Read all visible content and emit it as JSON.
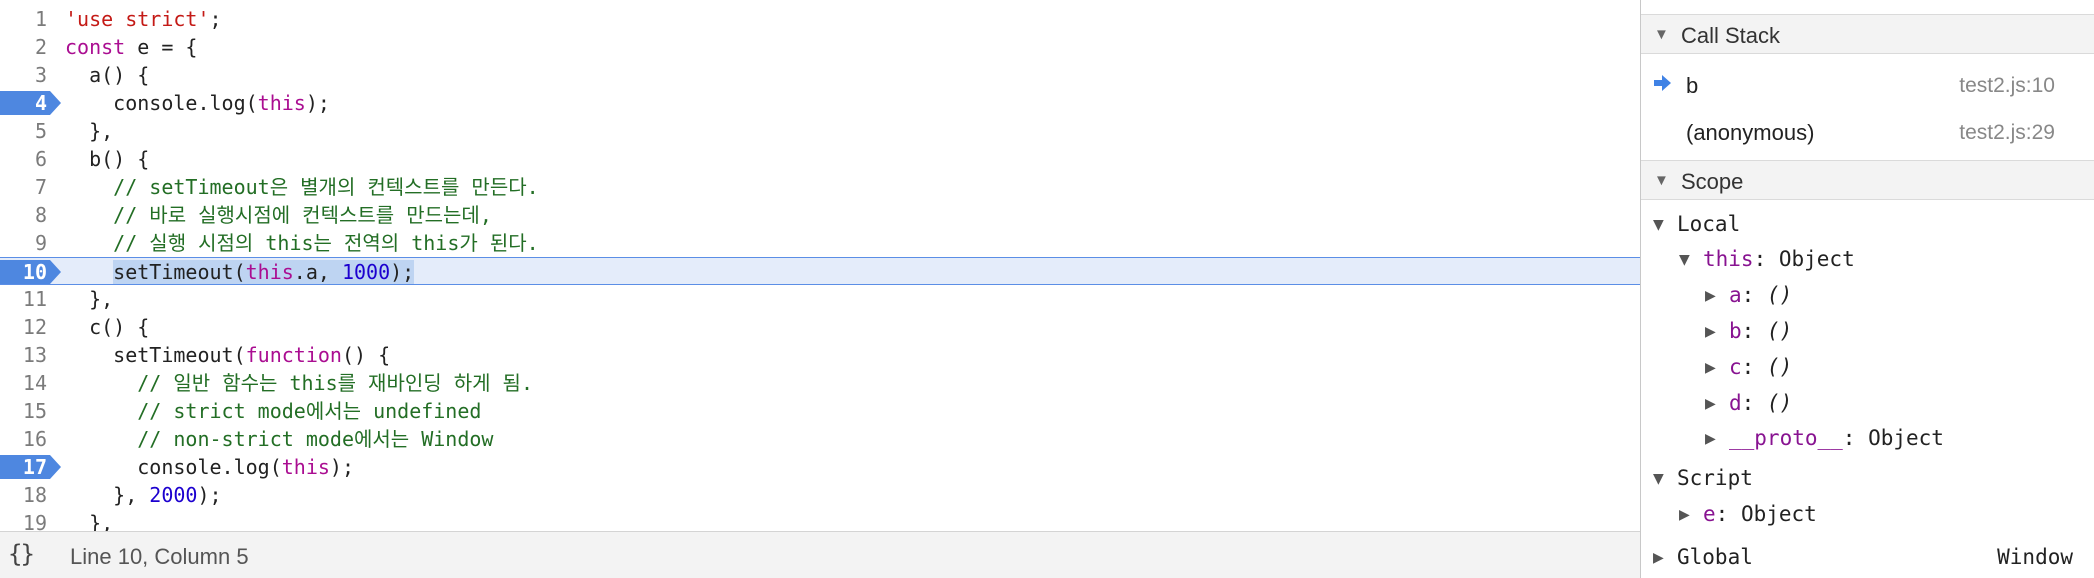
{
  "editor": {
    "lines": [
      {
        "num": "1",
        "tokens": [
          [
            "str",
            "'use strict'"
          ],
          [
            "plain",
            ";"
          ]
        ]
      },
      {
        "num": "2",
        "tokens": [
          [
            "kw",
            "const"
          ],
          [
            "plain",
            " e = {"
          ]
        ]
      },
      {
        "num": "3",
        "tokens": [
          [
            "plain",
            "  a() {"
          ]
        ]
      },
      {
        "num": "4",
        "breakpoint": true,
        "tokens": [
          [
            "plain",
            "    console.log("
          ],
          [
            "kw",
            "this"
          ],
          [
            "plain",
            ");"
          ]
        ]
      },
      {
        "num": "5",
        "tokens": [
          [
            "plain",
            "  },"
          ]
        ]
      },
      {
        "num": "6",
        "tokens": [
          [
            "plain",
            "  b() {"
          ]
        ]
      },
      {
        "num": "7",
        "tokens": [
          [
            "plain",
            "    "
          ],
          [
            "com",
            "// setTimeout은 별개의 컨텍스트를 만든다."
          ]
        ]
      },
      {
        "num": "8",
        "tokens": [
          [
            "plain",
            "    "
          ],
          [
            "com",
            "// 바로 실행시점에 컨텍스트를 만드는데,"
          ]
        ]
      },
      {
        "num": "9",
        "tokens": [
          [
            "plain",
            "    "
          ],
          [
            "com",
            "// 실행 시점의 this는 전역의 this가 된다."
          ]
        ]
      },
      {
        "num": "10",
        "breakpoint": true,
        "current": true,
        "tokens": [
          [
            "plain",
            "    "
          ],
          [
            "hl-plain",
            "setTimeout("
          ],
          [
            "hl-kw",
            "this"
          ],
          [
            "hl-plain",
            ".a, "
          ],
          [
            "hl-num",
            "1000"
          ],
          [
            "hl-plain",
            ");"
          ]
        ]
      },
      {
        "num": "11",
        "tokens": [
          [
            "plain",
            "  },"
          ]
        ]
      },
      {
        "num": "12",
        "tokens": [
          [
            "plain",
            "  c() {"
          ]
        ]
      },
      {
        "num": "13",
        "tokens": [
          [
            "plain",
            "    setTimeout("
          ],
          [
            "kw",
            "function"
          ],
          [
            "plain",
            "() {"
          ]
        ]
      },
      {
        "num": "14",
        "tokens": [
          [
            "plain",
            "      "
          ],
          [
            "com",
            "// 일반 함수는 this를 재바인딩 하게 됨."
          ]
        ]
      },
      {
        "num": "15",
        "tokens": [
          [
            "plain",
            "      "
          ],
          [
            "com",
            "// strict mode에서는 undefined"
          ]
        ]
      },
      {
        "num": "16",
        "tokens": [
          [
            "plain",
            "      "
          ],
          [
            "com",
            "// non-strict mode에서는 Window"
          ]
        ]
      },
      {
        "num": "17",
        "breakpoint": true,
        "tokens": [
          [
            "plain",
            "      console.log("
          ],
          [
            "kw",
            "this"
          ],
          [
            "plain",
            ");"
          ]
        ]
      },
      {
        "num": "18",
        "tokens": [
          [
            "plain",
            "    }, "
          ],
          [
            "num",
            "2000"
          ],
          [
            "plain",
            ");"
          ]
        ]
      },
      {
        "num": "19",
        "tokens": [
          [
            "plain",
            "  },"
          ]
        ]
      }
    ],
    "status": {
      "format_icon": "{}",
      "cursor_position": "Line 10, Column 5"
    }
  },
  "sidebar": {
    "call_stack": {
      "title": "Call Stack",
      "frames": [
        {
          "fn": "b",
          "location": "test2.js:10",
          "current": true
        },
        {
          "fn": "(anonymous)",
          "location": "test2.js:29",
          "current": false
        }
      ]
    },
    "scope": {
      "title": "Scope",
      "local_label": "Local",
      "this_name": "this",
      "this_value": ": Object",
      "this_props": [
        {
          "name": "a",
          "value": "()"
        },
        {
          "name": "b",
          "value": "()"
        },
        {
          "name": "c",
          "value": "()"
        },
        {
          "name": "d",
          "value": "()"
        }
      ],
      "proto_name": "__proto__",
      "proto_value": ": Object",
      "script_label": "Script",
      "script_var_name": "e",
      "script_var_value": ": Object",
      "global_label": "Global",
      "global_value": "Window"
    }
  },
  "colors": {
    "breakpoint": "#4e87e0",
    "current_line_bg": "#e4ecfa",
    "execution_highlight": "#bed4f2"
  }
}
